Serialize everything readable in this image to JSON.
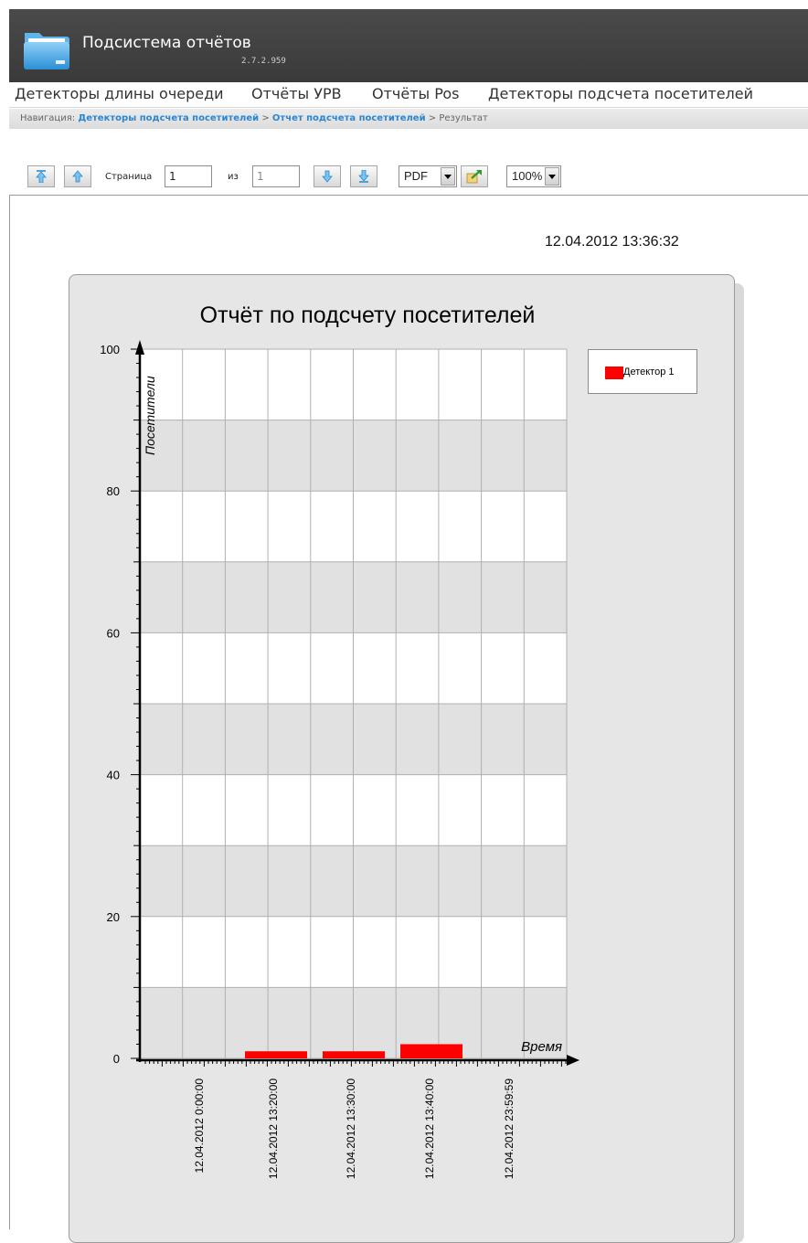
{
  "app": {
    "title": "Подсистема отчётов",
    "version": "2.7.2.959",
    "logo_icon": "folder-icon"
  },
  "menu": {
    "items": [
      {
        "label": "Детекторы длины очереди"
      },
      {
        "label": "Отчёты УРВ"
      },
      {
        "label": "Отчёты Pos"
      },
      {
        "label": "Детекторы подсчета посетителей"
      }
    ]
  },
  "breadcrumb": {
    "prefix": "Навигация:",
    "links": [
      "Детекторы подсчета посетителей",
      "Отчет подсчета посетителей"
    ],
    "separator": ">",
    "current": "Результат"
  },
  "toolbar": {
    "first_page_icon": "first-page-icon",
    "prev_page_icon": "prev-page-icon",
    "page_label": "Страница",
    "page_value": "1",
    "of_label": "из",
    "total_pages": "1",
    "next_page_icon": "next-page-icon",
    "last_page_icon": "last-page-icon",
    "export_format": "PDF",
    "export_icon": "export-icon",
    "zoom": "100%"
  },
  "report": {
    "generated_at": "12.04.2012 13:36:32"
  },
  "colors": {
    "bar": "#ff0000",
    "header_bg": "#404040",
    "link": "#2b86d1",
    "band": "#e1e1e1",
    "panel": "#e6e6e6"
  },
  "chart_data": {
    "type": "bar",
    "title": "Отчёт по подсчету посетителей",
    "xlabel": "Время",
    "ylabel": "Посетители",
    "ylim": [
      0,
      100
    ],
    "yticks": [
      "0",
      "20",
      "40",
      "60",
      "80",
      "100"
    ],
    "xtick_labels": [
      "12.04.2012 0:00:00",
      "12.04.2012 13:20:00",
      "12.04.2012 13:30:00",
      "12.04.2012 13:40:00",
      "12.04.2012 23:59:59"
    ],
    "bar_values": [
      1,
      1,
      2
    ],
    "grid": true,
    "legend_position": "top-right",
    "series": [
      {
        "name": "Детектор 1",
        "color": "#ff0000",
        "values": [
          1,
          1,
          2
        ]
      }
    ]
  }
}
